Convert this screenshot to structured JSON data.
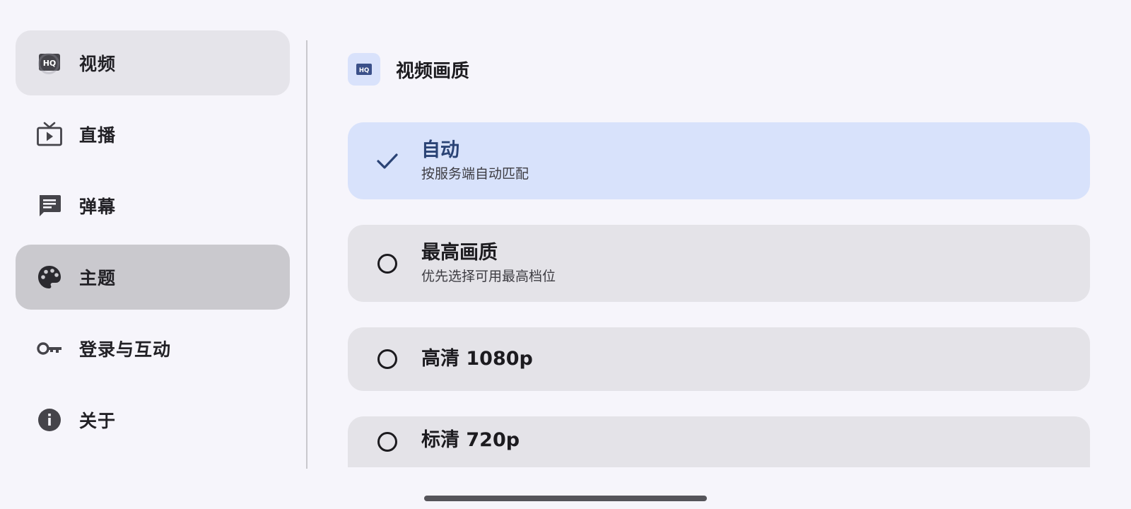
{
  "sidebar": {
    "items": [
      {
        "label": "视频",
        "icon": "hq-icon"
      },
      {
        "label": "直播",
        "icon": "live-tv-icon"
      },
      {
        "label": "弹幕",
        "icon": "comment-icon"
      },
      {
        "label": "主题",
        "icon": "palette-icon"
      },
      {
        "label": "登录与互动",
        "icon": "key-icon"
      },
      {
        "label": "关于",
        "icon": "info-icon"
      }
    ]
  },
  "main": {
    "section_title": "视频画质",
    "section_icon": "hq-icon",
    "hq_badge_text": "HQ",
    "options": [
      {
        "title": "自动",
        "subtitle": "按服务端自动匹配",
        "selected": true
      },
      {
        "title": "最高画质",
        "subtitle": "优先选择可用最高档位",
        "selected": false
      },
      {
        "title": "高清 1080p",
        "subtitle": "",
        "selected": false
      },
      {
        "title": "标清 720p",
        "subtitle": "",
        "selected": false
      }
    ]
  },
  "colors": {
    "background": "#f6f5fb",
    "selected_option": "#d8e2fb",
    "option": "#e4e3e8",
    "accent_text": "#2a4375"
  }
}
